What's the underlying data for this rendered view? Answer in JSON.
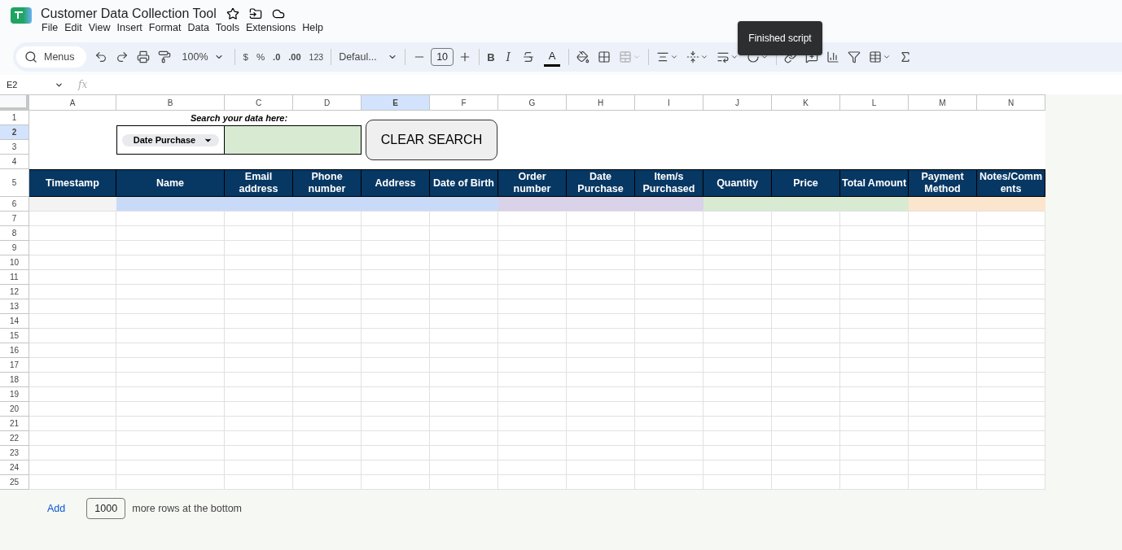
{
  "app": {
    "title": "Customer Data Collection Tool",
    "menu": [
      "File",
      "Edit",
      "View",
      "Insert",
      "Format",
      "Data",
      "Tools",
      "Extensions",
      "Help"
    ]
  },
  "toolbar": {
    "search": "Menus",
    "zoom": "100%",
    "currency": "$",
    "percent": "%",
    "decrease_decimals": ".0",
    "increase_decimals": ".00",
    "number_format": "123",
    "font": "Defaul...",
    "font_size": "10",
    "bold": "B",
    "italic": "I",
    "text_color": "A",
    "merge_disabled": true
  },
  "tooltip": "Finished script",
  "formula_bar": {
    "name_box": "E2",
    "fx": "fx"
  },
  "sheet": {
    "columns": [
      {
        "label": "A",
        "selected": false
      },
      {
        "label": "B",
        "selected": false
      },
      {
        "label": "C",
        "selected": false
      },
      {
        "label": "D",
        "selected": false
      },
      {
        "label": "E",
        "selected": true
      },
      {
        "label": "F",
        "selected": false
      },
      {
        "label": "G",
        "selected": false
      },
      {
        "label": "H",
        "selected": false
      },
      {
        "label": "I",
        "selected": false
      },
      {
        "label": "J",
        "selected": false
      },
      {
        "label": "K",
        "selected": false
      },
      {
        "label": "L",
        "selected": false
      },
      {
        "label": "M",
        "selected": false
      },
      {
        "label": "N",
        "selected": false
      }
    ],
    "rows": [
      {
        "label": "1",
        "selected": false
      },
      {
        "label": "2",
        "selected": true
      },
      {
        "label": "3",
        "selected": false
      },
      {
        "label": "4",
        "selected": false
      },
      {
        "label": "5",
        "selected": false
      },
      {
        "label": "6",
        "selected": false
      },
      {
        "label": "7",
        "selected": false
      },
      {
        "label": "8",
        "selected": false
      },
      {
        "label": "9",
        "selected": false
      },
      {
        "label": "10",
        "selected": false
      },
      {
        "label": "11",
        "selected": false
      },
      {
        "label": "12",
        "selected": false
      },
      {
        "label": "13",
        "selected": false
      },
      {
        "label": "14",
        "selected": false
      },
      {
        "label": "15",
        "selected": false
      },
      {
        "label": "16",
        "selected": false
      },
      {
        "label": "17",
        "selected": false
      },
      {
        "label": "18",
        "selected": false
      },
      {
        "label": "19",
        "selected": false
      },
      {
        "label": "20",
        "selected": false
      },
      {
        "label": "21",
        "selected": false
      },
      {
        "label": "22",
        "selected": false
      },
      {
        "label": "23",
        "selected": false
      },
      {
        "label": "24",
        "selected": false
      },
      {
        "label": "25",
        "selected": false
      }
    ],
    "search_label": "Search your data here:",
    "search_dropdown": "Date Purchase",
    "clear_button": "CLEAR SEARCH",
    "headers": [
      "Timestamp",
      "Name",
      "Email address",
      "Phone number",
      "Address",
      "Date of Birth",
      "Order number",
      "Date Purchase",
      "Item/s Purchased",
      "Quantity",
      "Price",
      "Total Amount",
      "Payment Method",
      "Notes/Comments"
    ],
    "row_6": [
      {
        "color": "#f3f3f3"
      },
      {
        "color": "#c9daf8"
      },
      {
        "color": "#c9daf8"
      },
      {
        "color": "#c9daf8"
      },
      {
        "color": "#c9daf8"
      },
      {
        "color": "#c9daf8"
      },
      {
        "color": "#d9d2e9"
      },
      {
        "color": "#d9d2e9"
      },
      {
        "color": "#d9d2e9"
      },
      {
        "color": "#d9ead3"
      },
      {
        "color": "#d9ead3"
      },
      {
        "color": "#d9ead3"
      },
      {
        "color": "#fce5cd"
      },
      {
        "color": "#fce5cd"
      }
    ]
  },
  "footer": {
    "add": "Add",
    "count": "1000",
    "text": "more rows at the bottom"
  }
}
